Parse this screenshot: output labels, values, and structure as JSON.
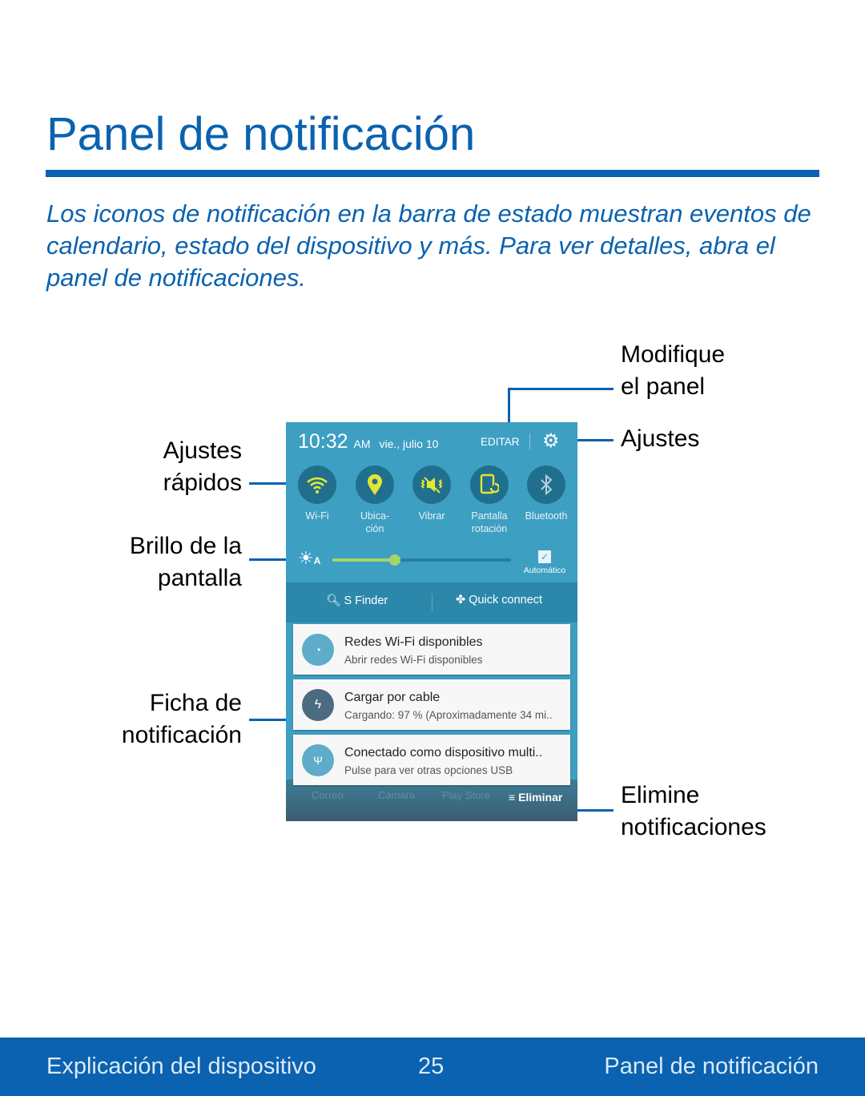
{
  "page": {
    "title": "Panel de notificación",
    "intro": "Los iconos de notificación en la barra de estado muestran eventos de calendario, estado del dispositivo y más. Para ver detalles, abra el panel de notificaciones.",
    "accent": "#0a62b0"
  },
  "callouts": {
    "modify_l1": "Modifique",
    "modify_l2": "el panel",
    "settings": "Ajustes",
    "quick_l1": "Ajustes",
    "quick_l2": "rápidos",
    "bright_l1": "Brillo de la",
    "bright_l2": "pantalla",
    "card_l1": "Ficha de",
    "card_l2": "notificación",
    "clear_l1": "Elimine",
    "clear_l2": "notificaciones"
  },
  "panel": {
    "time": "10:32",
    "ampm": "AM",
    "date": "vie., julio 10",
    "edit": "EDITAR",
    "quick_settings": [
      {
        "label": "Wi-Fi",
        "icon": "wifi-icon"
      },
      {
        "label": "Ubica-\nción",
        "icon": "location-icon"
      },
      {
        "label": "Vibrar",
        "icon": "vibrate-icon"
      },
      {
        "label": "Pantalla\nrotación",
        "icon": "rotation-icon"
      },
      {
        "label": "Bluetooth",
        "icon": "bluetooth-icon"
      }
    ],
    "brightness": {
      "level_percent": 35,
      "auto_label": "Automático",
      "auto_checked": true
    },
    "sfinder": "S Finder",
    "quick_connect": "Quick connect",
    "notifications": [
      {
        "title": "Redes Wi-Fi disponibles",
        "subtitle": "Abrir redes Wi-Fi disponibles",
        "icon": "wifi-question-icon"
      },
      {
        "title": "Cargar por cable",
        "subtitle": "Cargando: 97 % (Aproximadamente 34 mi..",
        "icon": "charging-icon"
      },
      {
        "title": "Conectado como dispositivo multi..",
        "subtitle": "Pulse para ver otras opciones USB",
        "icon": "usb-icon"
      }
    ],
    "dock": [
      "Correo",
      "Cámara",
      "Play Store"
    ],
    "clear": "Eliminar"
  },
  "footer": {
    "left": "Explicación del dispositivo",
    "page": "25",
    "right": "Panel de notificación"
  }
}
